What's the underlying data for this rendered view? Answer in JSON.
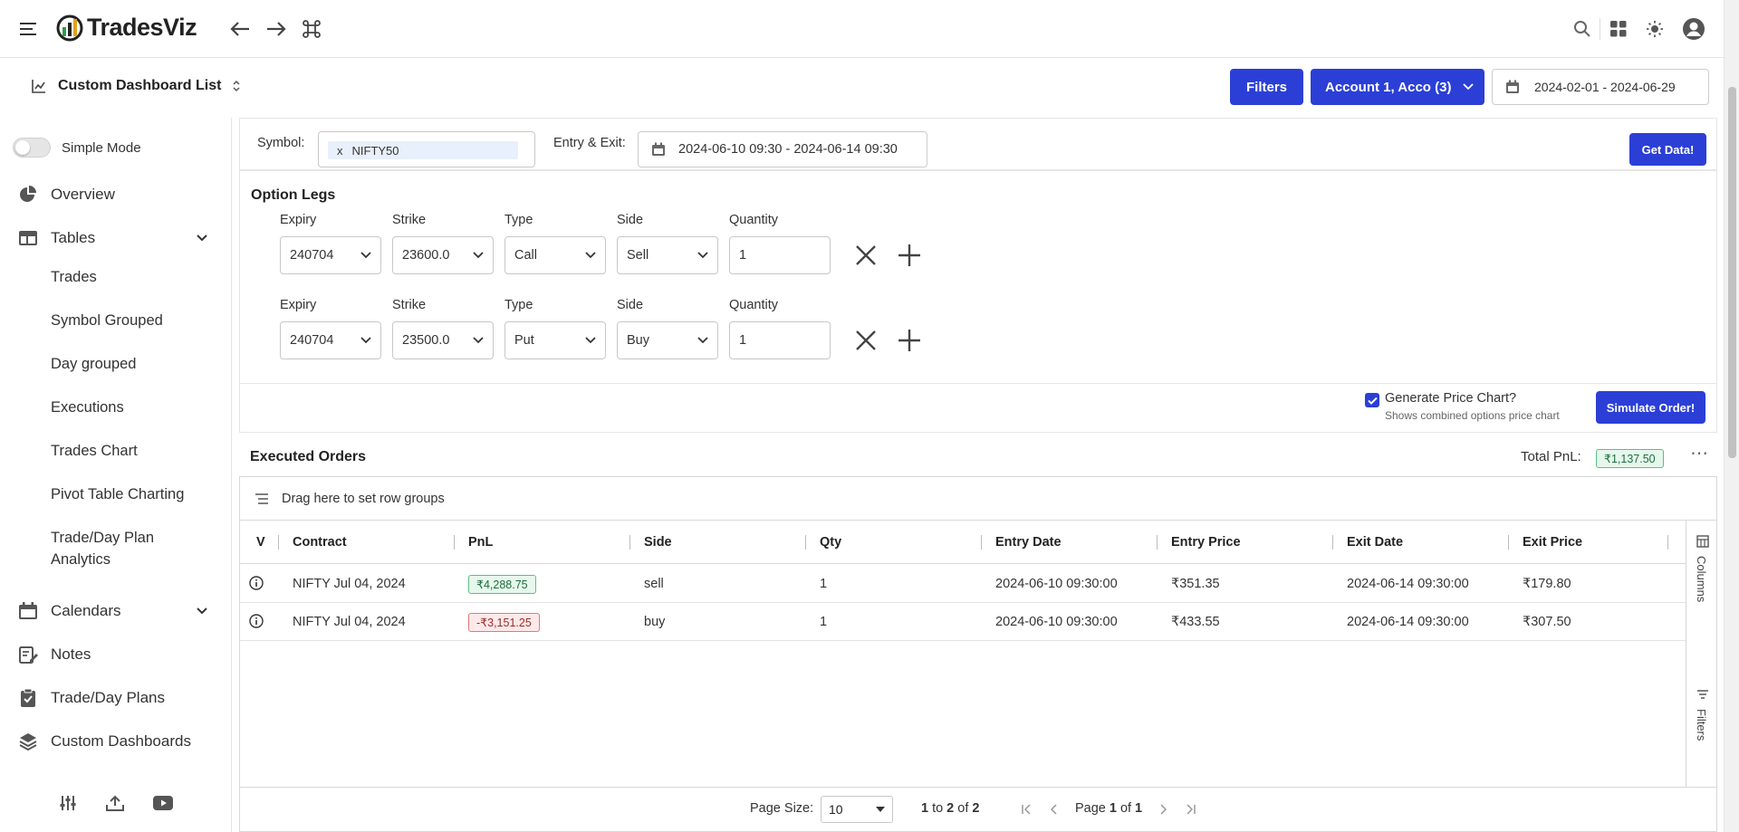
{
  "app": {
    "name": "TradesViz"
  },
  "header": {
    "dashboard_title": "Custom Dashboard List",
    "filters_label": "Filters",
    "account_label": "Account 1, Acco (3)",
    "date_range": "2024-02-01 - 2024-06-29"
  },
  "sidebar": {
    "simple_mode": "Simple Mode",
    "items": {
      "overview": "Overview",
      "tables": "Tables",
      "trades": "Trades",
      "symbol_grouped": "Symbol Grouped",
      "day_grouped": "Day grouped",
      "executions": "Executions",
      "trades_chart": "Trades Chart",
      "pivot": "Pivot Table Charting",
      "plan_analytics_1": "Trade/Day Plan",
      "plan_analytics_2": "Analytics",
      "calendars": "Calendars",
      "notes": "Notes",
      "plans": "Trade/Day Plans",
      "custom_dashboards": "Custom Dashboards"
    }
  },
  "query": {
    "symbol_label": "Symbol:",
    "symbol_remove": "x",
    "symbol_value": "NIFTY50",
    "entry_exit_label": "Entry & Exit:",
    "entry_exit_value": "2024-06-10 09:30 - 2024-06-14 09:30",
    "get_data": "Get Data!"
  },
  "option_legs": {
    "title": "Option Legs",
    "labels": {
      "expiry": "Expiry",
      "strike": "Strike",
      "type": "Type",
      "side": "Side",
      "quantity": "Quantity"
    },
    "legs": [
      {
        "expiry": "240704",
        "strike": "23600.0",
        "type": "Call",
        "side": "Sell",
        "quantity": "1"
      },
      {
        "expiry": "240704",
        "strike": "23500.0",
        "type": "Put",
        "side": "Buy",
        "quantity": "1"
      }
    ]
  },
  "simulate": {
    "generate_label": "Generate Price Chart?",
    "generate_sub": "Shows combined options price chart",
    "generate_checked": true,
    "button": "Simulate Order!"
  },
  "orders": {
    "title": "Executed Orders",
    "total_label": "Total PnL:",
    "total_value": "₹1,137.50",
    "row_group_hint": "Drag here to set row groups",
    "columns": [
      "V",
      "Contract",
      "PnL",
      "Side",
      "Qty",
      "Entry Date",
      "Entry Price",
      "Exit Date",
      "Exit Price"
    ],
    "rows": [
      {
        "contract": "NIFTY Jul 04, 2024",
        "pnl": "₹4,288.75",
        "pnl_positive": true,
        "side": "sell",
        "qty": "1",
        "entry_date": "2024-06-10 09:30:00",
        "entry_price": "₹351.35",
        "exit_date": "2024-06-14 09:30:00",
        "exit_price": "₹179.80"
      },
      {
        "contract": "NIFTY Jul 04, 2024",
        "pnl": "-₹3,151.25",
        "pnl_positive": false,
        "side": "buy",
        "qty": "1",
        "entry_date": "2024-06-10 09:30:00",
        "entry_price": "₹433.55",
        "exit_date": "2024-06-14 09:30:00",
        "exit_price": "₹307.50"
      }
    ],
    "side_tabs": {
      "columns": "Columns",
      "filters": "Filters"
    },
    "pagination": {
      "page_size_label": "Page Size:",
      "page_size": "10",
      "range_from": "1",
      "to_word": "to",
      "range_to": "2",
      "of_word": "of",
      "total": "2",
      "page_word": "Page",
      "page": "1",
      "page_of": "of",
      "pages": "1"
    }
  },
  "colors": {
    "accent": "#2b3fd6",
    "positive": "#5cbf86",
    "negative": "#e27878"
  }
}
